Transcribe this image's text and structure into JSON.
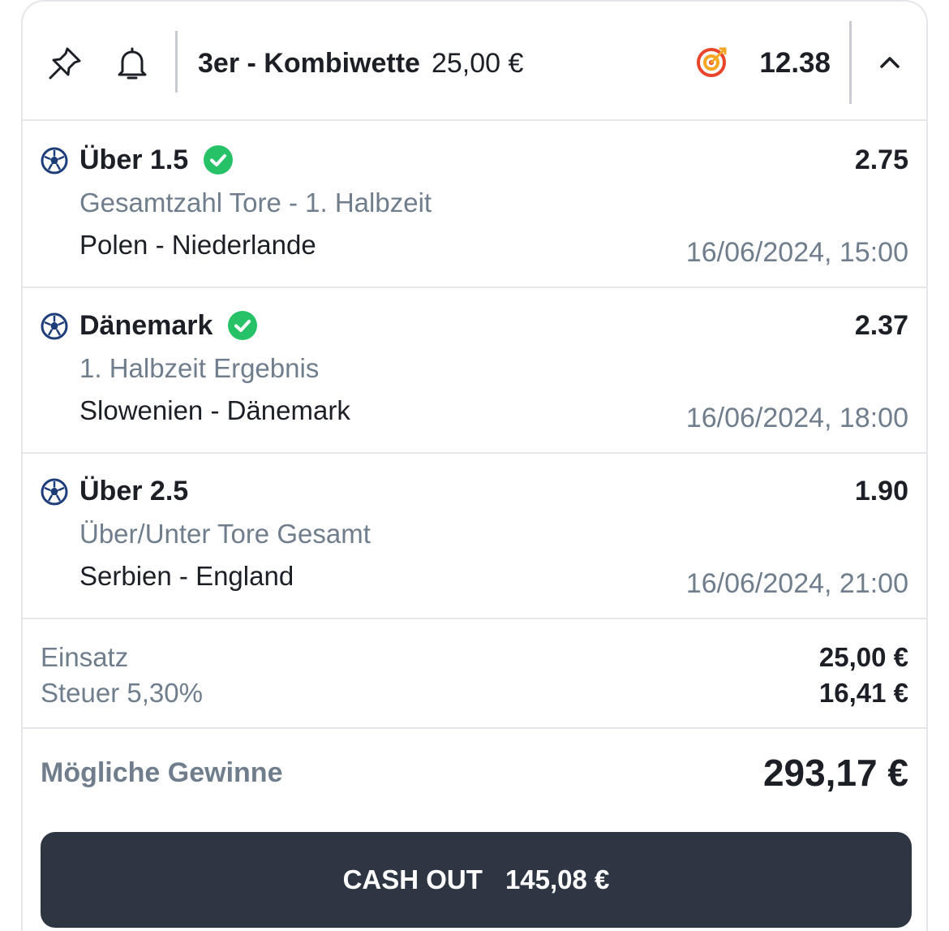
{
  "header": {
    "icons": [
      "pin-icon",
      "bell-icon",
      "target-icon",
      "chevron-up-icon"
    ],
    "bet_type": "3er - Kombiwette",
    "stake": "25,00 €",
    "total_odds": "12.38"
  },
  "bets": [
    {
      "icon": "soccer-ball-icon",
      "selection": "Über 1.5",
      "won": true,
      "odds": "2.75",
      "market": "Gesamtzahl Tore - 1. Halbzeit",
      "match": "Polen - Niederlande",
      "datetime": "16/06/2024, 15:00"
    },
    {
      "icon": "soccer-ball-icon",
      "selection": "Dänemark",
      "won": true,
      "odds": "2.37",
      "market": "1. Halbzeit Ergebnis",
      "match": "Slowenien - Dänemark",
      "datetime": "16/06/2024, 18:00"
    },
    {
      "icon": "soccer-ball-icon",
      "selection": "Über 2.5",
      "won": false,
      "odds": "1.90",
      "market": "Über/Unter Tore Gesamt",
      "match": "Serbien - England",
      "datetime": "16/06/2024, 21:00"
    }
  ],
  "summary": {
    "stake_label": "Einsatz",
    "stake_value": "25,00 €",
    "tax_label": "Steuer 5,30%",
    "tax_value": "16,41 €",
    "winnings_label": "Mögliche Gewinne",
    "winnings_value": "293,17 €"
  },
  "cashout": {
    "label": "CASH OUT",
    "amount": "145,08 €"
  },
  "colors": {
    "text_dark": "#1c1f26",
    "text_muted": "#6f7d8c",
    "divider": "#e4e6ea",
    "check_green": "#27c267",
    "ball_blue": "#1d3d7a",
    "target_red": "#e8452c",
    "target_orange": "#f5a623",
    "button_bg": "#2e3644"
  }
}
